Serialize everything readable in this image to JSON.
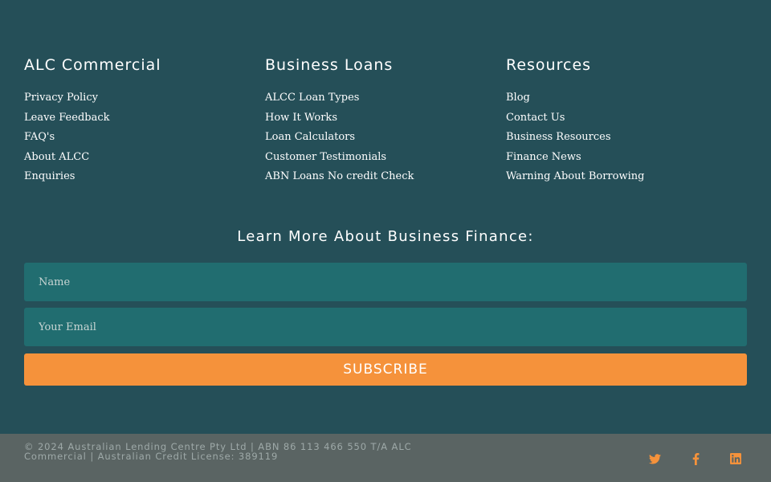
{
  "columns": [
    {
      "title": "ALC Commercial",
      "links": [
        "Privacy Policy",
        "Leave Feedback",
        "FAQ's",
        "About ALCC",
        "Enquiries"
      ]
    },
    {
      "title": "Business Loans",
      "links": [
        "ALCC Loan Types",
        "How It Works",
        "Loan Calculators",
        "Customer Testimonials",
        "ABN Loans No credit Check"
      ]
    },
    {
      "title": "Resources",
      "links": [
        "Blog",
        "Contact Us",
        "Business Resources",
        "Finance News",
        "Warning About Borrowing"
      ]
    }
  ],
  "newsletter": {
    "title": "Learn More About Business Finance:",
    "name_placeholder": "Name",
    "email_placeholder": "Your Email",
    "subscribe_label": "SUBSCRIBE"
  },
  "bottom": {
    "copyright": "© 2024 Australian Lending Centre Pty Ltd | ABN 86 113 466 550 T/A ALC Commercial | Australian Credit License: 389119",
    "social_icons": [
      "twitter-icon",
      "facebook-icon",
      "linkedin-icon"
    ]
  },
  "colors": {
    "background": "#254f58",
    "input_bg": "#216d70",
    "accent": "#f5923b",
    "bottom_bar": "#5a6463"
  }
}
